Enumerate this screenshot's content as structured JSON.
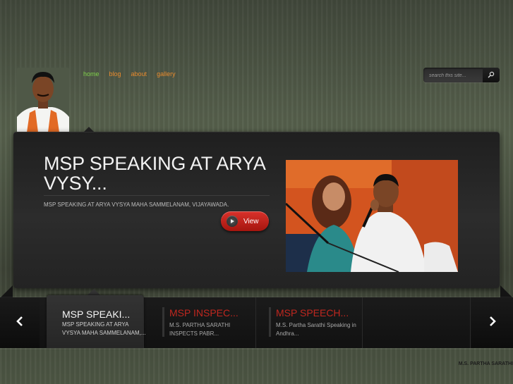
{
  "nav": {
    "items": [
      {
        "label": "home",
        "active": true
      },
      {
        "label": "blog",
        "active": false
      },
      {
        "label": "about",
        "active": false
      },
      {
        "label": "gallery",
        "active": false
      }
    ]
  },
  "search": {
    "placeholder": "search this site...",
    "icon": "search-icon"
  },
  "featured": {
    "title": "MSP SPEAKING AT ARYA VYSY...",
    "description": "MSP SPEAKING AT ARYA VYSYA MAHA SAMMELANAM, VIJAYAWADA.",
    "view_label": "View"
  },
  "thumbnails": [
    {
      "title": "MSP SPEAKI...",
      "text": "MSP SPEAKING AT ARYA VYSYA MAHA SAMMELANAM,..."
    },
    {
      "title": "MSP INSPEC...",
      "text": "M.S. PARTHA SARATHI INSPECTS PABR..."
    },
    {
      "title": "MSP SPEECH...",
      "text": "M.S. Partha Sarathi Speaking in Andhra..."
    }
  ],
  "colors": {
    "nav_active": "#7fd14a",
    "nav_link": "#e88a2d",
    "accent_red": "#c0271f",
    "button_red": "#d9312b"
  },
  "footer": {
    "text": "M.S. PARTHA SARATHI"
  }
}
